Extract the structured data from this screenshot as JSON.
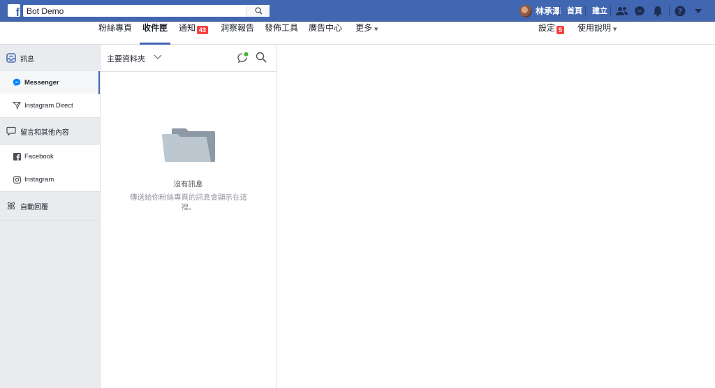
{
  "topbar": {
    "search_value": "Bot Demo",
    "user_name": "林承澤",
    "links": {
      "home": "首頁",
      "create": "建立"
    }
  },
  "nav": {
    "items": [
      {
        "label": "粉絲專頁"
      },
      {
        "label": "收件匣",
        "active": true
      },
      {
        "label": "通知",
        "badge": "43"
      },
      {
        "label": "洞察報告"
      },
      {
        "label": "發佈工具"
      },
      {
        "label": "廣告中心"
      },
      {
        "label": "更多"
      }
    ],
    "settings": {
      "label": "設定",
      "badge": "5"
    },
    "help": {
      "label": "使用說明"
    }
  },
  "sidebar": {
    "messages_section": "訊息",
    "messenger": "Messenger",
    "instagram_direct": "Instagram Direct",
    "comments_section": "留言和其他內容",
    "facebook": "Facebook",
    "instagram": "Instagram",
    "auto_reply": "自動回覆"
  },
  "folder": {
    "title": "主要資料夾",
    "empty_title": "沒有訊息",
    "empty_desc": "傳送給你粉絲專頁的訊息會顯示在這裡。"
  },
  "colors": {
    "brand_blue": "#4267b2",
    "badge_red": "#fa3e3e",
    "online_green": "#42b72a"
  }
}
